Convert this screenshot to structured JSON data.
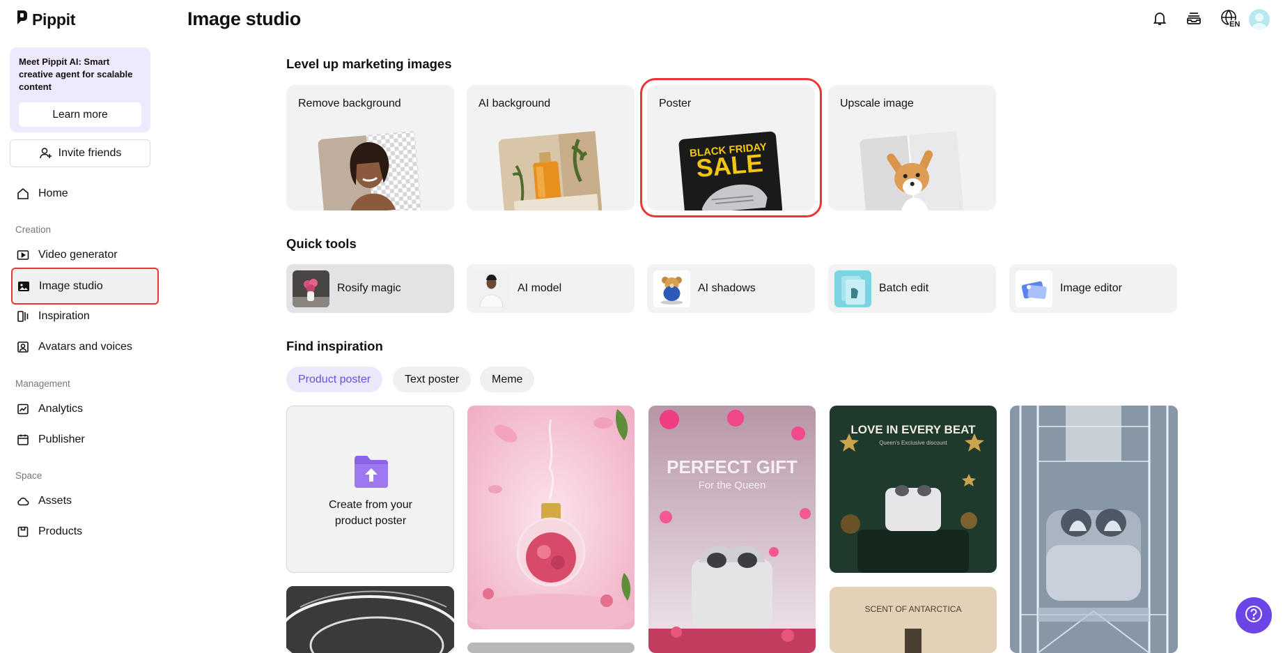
{
  "app": {
    "brand": "Pippit",
    "page_title": "Image studio",
    "language_badge": "EN"
  },
  "promo": {
    "text": "Meet Pippit AI: Smart creative agent for scalable content",
    "button": "Learn more"
  },
  "invite": {
    "label": "Invite friends"
  },
  "nav": {
    "home": "Home",
    "section_creation": "Creation",
    "video_generator": "Video generator",
    "image_studio": "Image studio",
    "inspiration": "Inspiration",
    "avatars_voices": "Avatars and voices",
    "section_management": "Management",
    "analytics": "Analytics",
    "publisher": "Publisher",
    "section_space": "Space",
    "assets": "Assets",
    "products": "Products"
  },
  "marketing": {
    "title": "Level up marketing images",
    "cards": [
      {
        "label": "Remove background"
      },
      {
        "label": "AI background"
      },
      {
        "label": "Poster",
        "poster_line1": "BLACK FRIDAY",
        "poster_line2": "SALE"
      },
      {
        "label": "Upscale image"
      }
    ]
  },
  "quick_tools": {
    "title": "Quick tools",
    "items": [
      {
        "label": "Rosify magic"
      },
      {
        "label": "AI model"
      },
      {
        "label": "AI shadows"
      },
      {
        "label": "Batch edit"
      },
      {
        "label": "Image editor"
      }
    ]
  },
  "inspiration": {
    "title": "Find inspiration",
    "chips": [
      "Product poster",
      "Text poster",
      "Meme"
    ],
    "create_card": "Create from your product poster",
    "poster_gift_title": "PERFECT GIFT",
    "poster_gift_sub": "For the Queen",
    "poster_love_title": "LOVE IN EVERY BEAT",
    "poster_love_sub": "Queen's Exclusive discount",
    "poster_antarctica": "SCENT OF ANTARCTICA"
  },
  "colors": {
    "accent": "#6d45e6",
    "highlight": "#e33333",
    "promo_bg": "#efe9fd"
  },
  "icons": [
    "bell-icon",
    "inbox-icon",
    "globe-icon",
    "home-icon",
    "video-icon",
    "image-icon",
    "inspiration-icon",
    "avatar-icon",
    "analytics-icon",
    "calendar-icon",
    "cloud-icon",
    "box-icon",
    "help-icon",
    "upload-folder-icon",
    "user-plus-icon"
  ]
}
